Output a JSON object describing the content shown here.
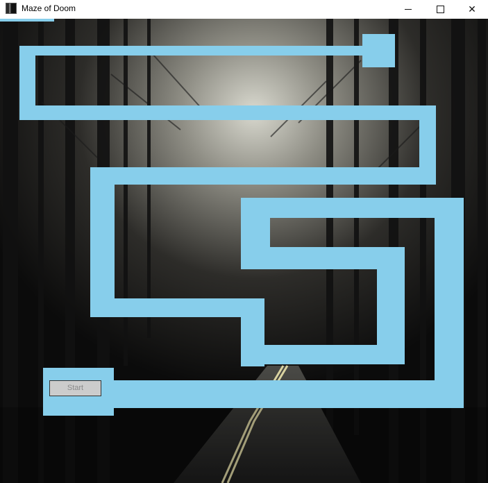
{
  "window": {
    "title": "Maze of Doom",
    "icons": {
      "app": "app-forest-icon",
      "minimize": "minimize-icon",
      "maximize": "maximize-icon",
      "close": "close-icon"
    },
    "close_glyph": "✕"
  },
  "game": {
    "start_label": "Start",
    "colors": {
      "maze": "#87ceeb",
      "start_button": "#cccccc",
      "start_text": "#8a8a8a"
    }
  }
}
